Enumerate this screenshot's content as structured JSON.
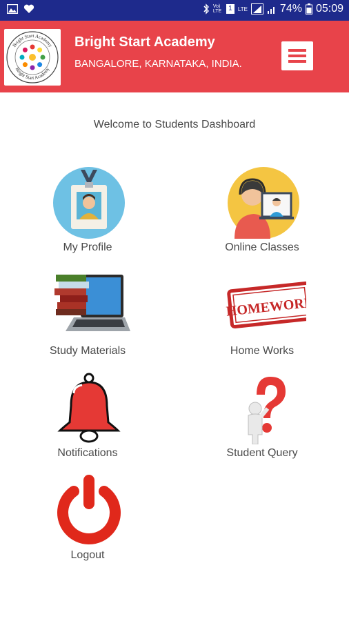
{
  "status_bar": {
    "left_icons": [
      "image-icon",
      "heart-icon"
    ],
    "right_icons": [
      "bluetooth-icon",
      "volte-icon",
      "sim-icon",
      "lte-icon",
      "signal-icon"
    ],
    "volte_text": "Vo)\nLTE",
    "sim_text": "1",
    "lte_text": "LTE",
    "battery_percent": "74%",
    "time": "05:09"
  },
  "header": {
    "title": "Bright Start Academy",
    "subtitle": "BANGALORE, KARNATAKA, INDIA.",
    "logo_text_top": "Bright Start Academy",
    "logo_text_bottom": "Bright Start Academy",
    "menu_icon": "hamburger-icon",
    "colors": {
      "header": "#e8434a",
      "status_bar": "#1e2a8c"
    }
  },
  "welcome": "Welcome to Students Dashboard",
  "tiles": [
    {
      "label": "My Profile",
      "icon": "profile-badge-icon"
    },
    {
      "label": "Online Classes",
      "icon": "online-classes-icon"
    },
    {
      "label": "Study Materials",
      "icon": "laptop-books-icon"
    },
    {
      "label": "Home Works",
      "icon": "homework-stamp-icon"
    },
    {
      "label": "Notifications",
      "icon": "bell-icon"
    },
    {
      "label": "Student Query",
      "icon": "question-mark-icon"
    },
    {
      "label": "Logout",
      "icon": "power-icon"
    }
  ],
  "homework_stamp_text": "HOMEWORK"
}
